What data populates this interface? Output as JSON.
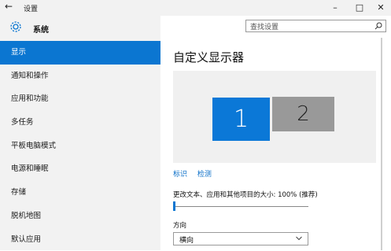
{
  "window": {
    "title": "设置",
    "back_icon": "arrow-left-icon",
    "controls": {
      "minimize": "–",
      "maximize": "□",
      "close": "✕"
    }
  },
  "sidebar": {
    "header_label": "系统",
    "header_icon": "gear-icon",
    "items": [
      {
        "label": "显示",
        "active": true
      },
      {
        "label": "通知和操作"
      },
      {
        "label": "应用和功能"
      },
      {
        "label": "多任务"
      },
      {
        "label": "平板电脑模式"
      },
      {
        "label": "电源和睡眠"
      },
      {
        "label": "存储"
      },
      {
        "label": "脱机地图"
      },
      {
        "label": "默认应用"
      }
    ]
  },
  "search": {
    "placeholder": "查找设置",
    "icon": "search-icon"
  },
  "main": {
    "title": "自定义显示器",
    "monitors": [
      "1",
      "2"
    ],
    "links": [
      "标识",
      "检测"
    ],
    "scale_label": "更改文本、应用和其他项目的大小: 100% (推荐)",
    "scale_level": 0,
    "orientation_label": "方向",
    "orientation_value": "横向"
  },
  "colors": {
    "accent": "#0b76d1",
    "sidebar_bg": "#f2f2f2",
    "secondary_monitor": "#999999"
  }
}
